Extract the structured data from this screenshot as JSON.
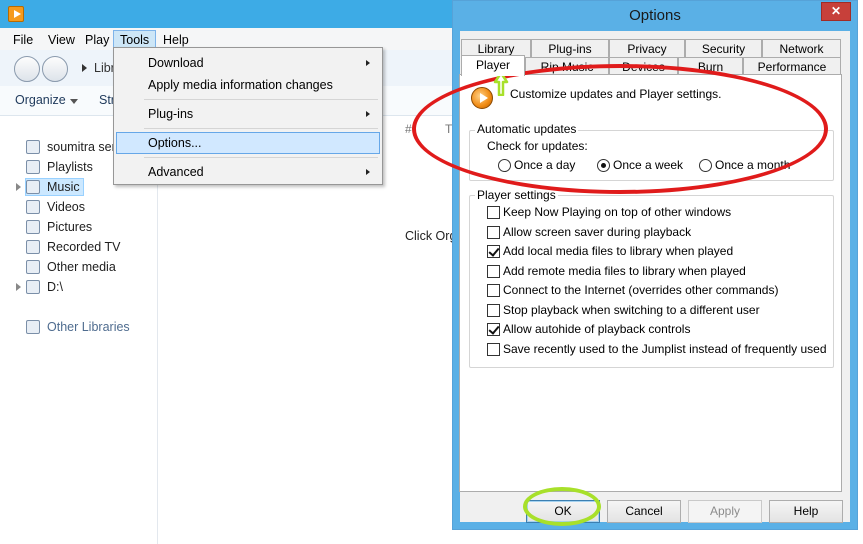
{
  "wmp": {
    "menubar": [
      "File",
      "View",
      "Play",
      "Tools",
      "Help"
    ],
    "breadcrumb": "Libr",
    "toolbar": {
      "organize": "Organize",
      "stream": "Str"
    },
    "nav_items": [
      {
        "label": "soumitra ser",
        "icon": "user-icon"
      },
      {
        "label": "Playlists",
        "icon": "playlist-icon"
      },
      {
        "label": "Music",
        "icon": "music-icon",
        "selected": true
      },
      {
        "label": "Videos",
        "icon": "video-icon"
      },
      {
        "label": "Pictures",
        "icon": "picture-icon"
      },
      {
        "label": "Recorded TV",
        "icon": "tv-icon"
      },
      {
        "label": "Other media",
        "icon": "media-icon"
      },
      {
        "label": "D:\\",
        "icon": "drive-icon"
      },
      {
        "label": "Other Libraries",
        "icon": "libraries-icon"
      }
    ],
    "content": {
      "col_hash": "#",
      "col_t": "T",
      "hint": "Click Org"
    }
  },
  "tools_menu": {
    "items": [
      "Download",
      "Apply media information changes",
      "Plug-ins",
      "Options...",
      "Advanced"
    ]
  },
  "dialog": {
    "title": "Options",
    "close_label": "✕",
    "tabs_row1": [
      "Library",
      "Plug-ins",
      "Privacy",
      "Security",
      "Network"
    ],
    "tabs_row2": [
      "Player",
      "Rip Music",
      "Devices",
      "Burn",
      "Performance"
    ],
    "intro": "Customize updates and Player settings.",
    "auto_updates": {
      "legend": "Automatic updates",
      "check_label": "Check for updates:",
      "options": [
        "Once a day",
        "Once a week",
        "Once a month"
      ],
      "selected": "Once a week"
    },
    "player_settings": {
      "legend": "Player settings",
      "items": [
        {
          "label": "Keep Now Playing on top of other windows",
          "checked": false
        },
        {
          "label": "Allow screen saver during playback",
          "checked": false
        },
        {
          "label": "Add local media files to library when played",
          "checked": true
        },
        {
          "label": "Add remote media files to library when played",
          "checked": false
        },
        {
          "label": "Connect to the Internet (overrides other commands)",
          "checked": false
        },
        {
          "label": "Stop playback when switching to a different user",
          "checked": false
        },
        {
          "label": "Allow autohide of playback controls",
          "checked": true
        },
        {
          "label": "Save recently used to the Jumplist instead of frequently used",
          "checked": false
        }
      ]
    },
    "buttons": {
      "ok": "OK",
      "cancel": "Cancel",
      "apply": "Apply",
      "help": "Help"
    }
  },
  "annotation_colors": {
    "red_ellipse": "#e01b1b",
    "green_marks": "#a8e02a"
  }
}
